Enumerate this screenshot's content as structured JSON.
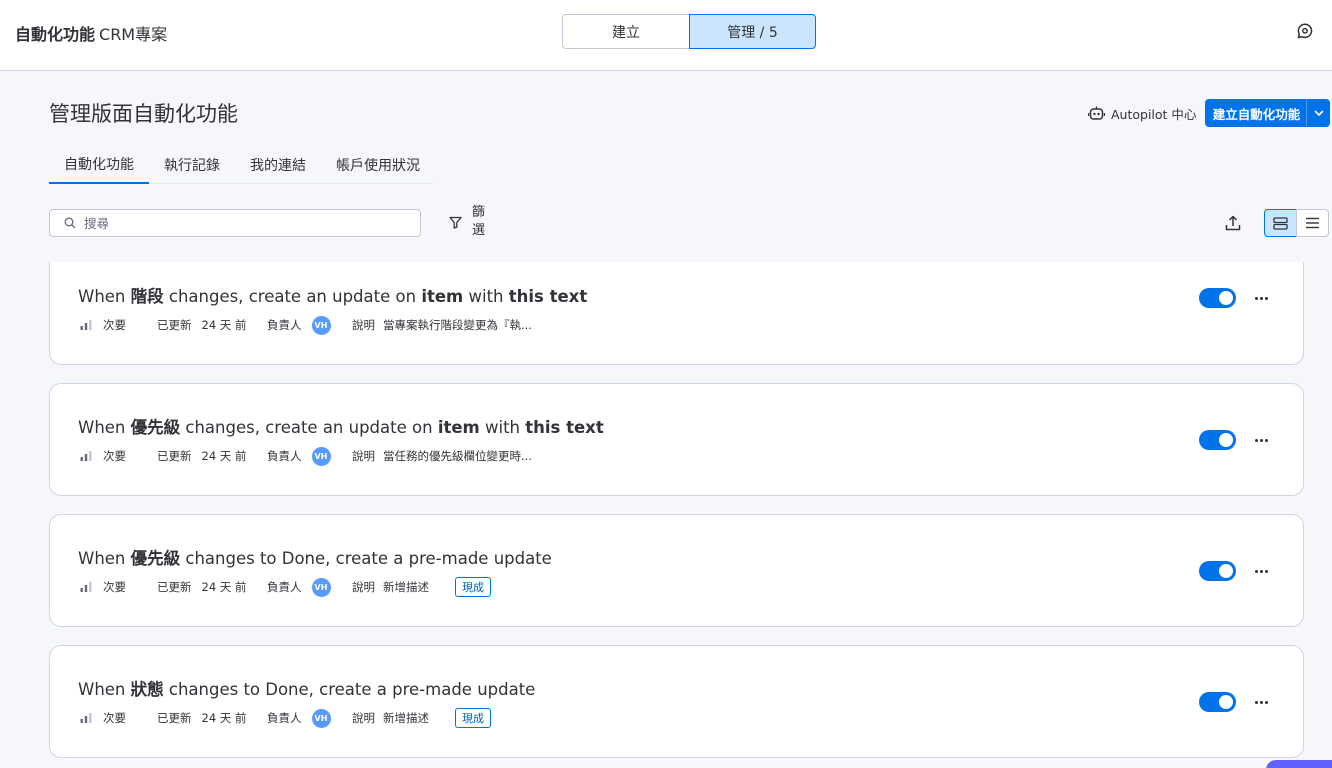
{
  "header": {
    "app_name": "自動化功能",
    "board_name": "CRM專案",
    "mode_create": "建立",
    "mode_manage": "管理 / 5",
    "help_icon": "chat-help-icon"
  },
  "page": {
    "title": "管理版面自動化功能",
    "autopilot_label": "Autopilot 中心",
    "create_button": "建立自動化功能"
  },
  "tabs": [
    {
      "label": "自動化功能",
      "active": true
    },
    {
      "label": "執行記錄",
      "active": false
    },
    {
      "label": "我的連結",
      "active": false
    },
    {
      "label": "帳戶使用狀況",
      "active": false
    }
  ],
  "toolbar": {
    "search_placeholder": "搜尋",
    "filter_label": "篩選"
  },
  "automations": [
    {
      "t1": "When ",
      "t2": "階段",
      "t3": " changes, create an update on ",
      "t4": "item",
      "t5": " with ",
      "t6": "this text",
      "priority": "次要",
      "updated_label": "已更新",
      "updated_value": "24 天 前",
      "owner_label": "負責人",
      "owner_initials": "VH",
      "desc_label": "說明",
      "desc_value": "當專案執行階段變更為『執...",
      "tag": "",
      "enabled": true
    },
    {
      "t1": "When ",
      "t2": "優先級",
      "t3": " changes, create an update on ",
      "t4": "item",
      "t5": " with ",
      "t6": "this text",
      "priority": "次要",
      "updated_label": "已更新",
      "updated_value": "24 天 前",
      "owner_label": "負責人",
      "owner_initials": "VH",
      "desc_label": "說明",
      "desc_value": "當任務的優先級欄位變更時...",
      "tag": "",
      "enabled": true
    },
    {
      "t1": "When ",
      "t2": "優先級",
      "t3": " changes to Done, create a pre-made update",
      "t4": "",
      "t5": "",
      "t6": "",
      "priority": "次要",
      "updated_label": "已更新",
      "updated_value": "24 天 前",
      "owner_label": "負責人",
      "owner_initials": "VH",
      "desc_label": "說明",
      "desc_value": "新增描述",
      "tag": "現成",
      "enabled": true
    },
    {
      "t1": "When ",
      "t2": "狀態",
      "t3": " changes to Done, create a pre-made update",
      "t4": "",
      "t5": "",
      "t6": "",
      "priority": "次要",
      "updated_label": "已更新",
      "updated_value": "24 天 前",
      "owner_label": "負責人",
      "owner_initials": "VH",
      "desc_label": "說明",
      "desc_value": "新增描述",
      "tag": "現成",
      "enabled": true
    }
  ],
  "colors": {
    "accent": "#0073ea",
    "accent_light": "#cce5ff",
    "avatar": "#579bfc",
    "background": "#f6f7fb"
  }
}
